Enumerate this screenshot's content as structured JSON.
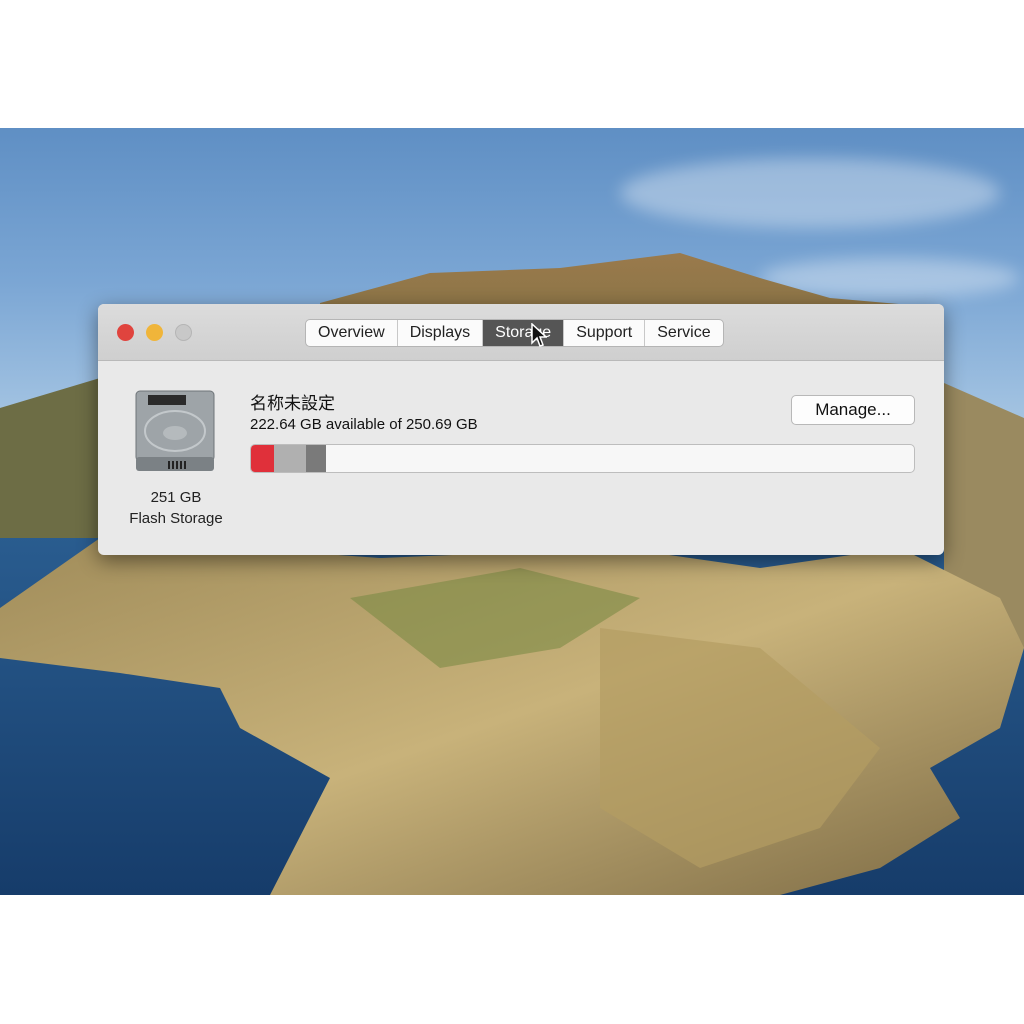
{
  "window": {
    "tabs": [
      {
        "label": "Overview",
        "active": false
      },
      {
        "label": "Displays",
        "active": false
      },
      {
        "label": "Storage",
        "active": true
      },
      {
        "label": "Support",
        "active": false
      },
      {
        "label": "Service",
        "active": false
      }
    ],
    "traffic_lights": {
      "close": "#e0443e",
      "minimize": "#f0b53a",
      "zoom": "#c4c4c4"
    }
  },
  "storage": {
    "drive_icon": "hard-drive-icon",
    "capacity": "251 GB",
    "type": "Flash Storage",
    "volume_name": "名称未設定",
    "available_text": "222.64 GB available of 250.69 GB",
    "manage_label": "Manage...",
    "usage_segments": [
      {
        "color": "#e0303a",
        "percent": 3.5
      },
      {
        "color": "#b0b0b0",
        "percent": 4.8
      },
      {
        "color": "#7a7a7a",
        "percent": 3.0
      }
    ]
  }
}
